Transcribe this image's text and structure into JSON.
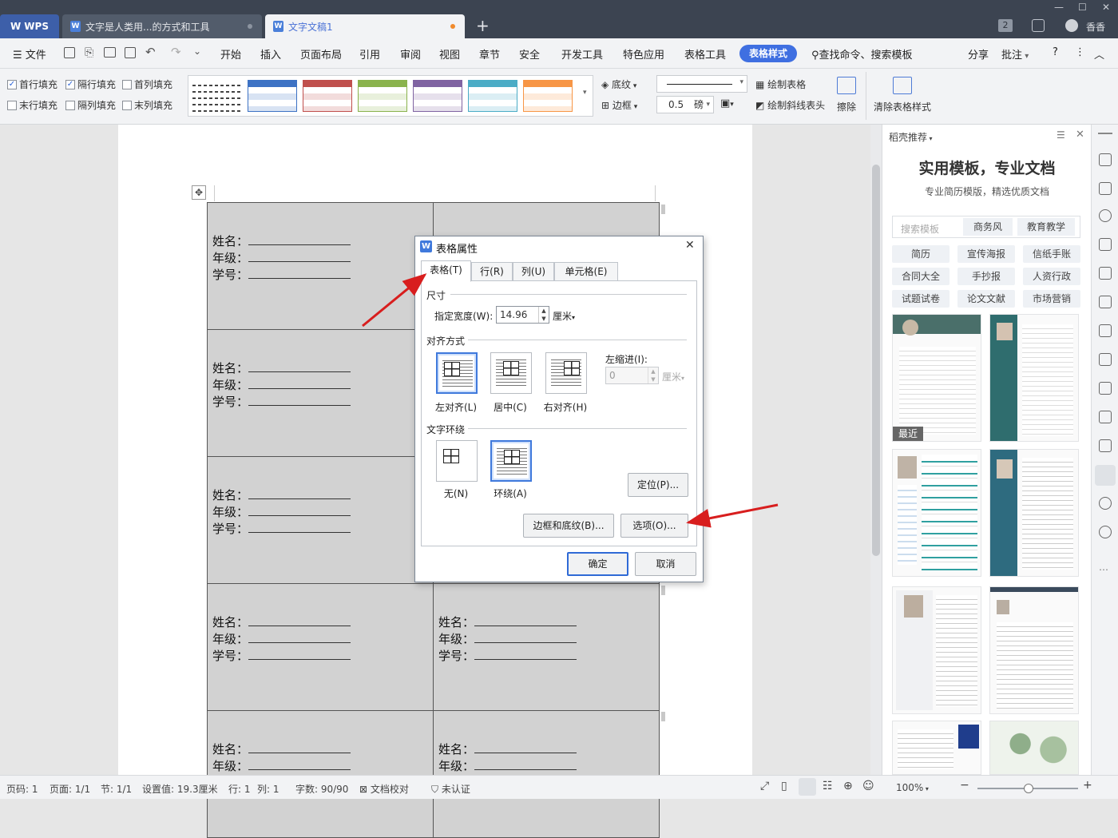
{
  "titlebar": {
    "wps_tab": "WPS",
    "tab1": "文字是人类用...的方式和工具",
    "tab2": "文字文稿1",
    "add_tab": "+",
    "badge": "2",
    "user": "香香"
  },
  "menubar": {
    "file": "文件",
    "items": [
      "开始",
      "插入",
      "页面布局",
      "引用",
      "审阅",
      "视图",
      "章节",
      "安全",
      "开发工具",
      "特色应用",
      "表格工具"
    ],
    "active": "表格样式",
    "search": "查找命令、搜索模板",
    "share": "分享",
    "comment": "批注"
  },
  "ribbon": {
    "checks": [
      {
        "label": "首行填充",
        "checked": true
      },
      {
        "label": "隔行填充",
        "checked": true
      },
      {
        "label": "首列填充",
        "checked": false
      },
      {
        "label": "末行填充",
        "checked": false
      },
      {
        "label": "隔列填充",
        "checked": false
      },
      {
        "label": "末列填充",
        "checked": false
      }
    ],
    "style_colors": [
      "#6b6b6b",
      "#3d72c4",
      "#c0504d",
      "#8ab34d",
      "#8064a2",
      "#4bacc6",
      "#f79646"
    ],
    "shading": "底纹",
    "border": "边框",
    "line_width": "0.5",
    "line_unit": "磅",
    "draw_table": "绘制表格",
    "draw_diagonal": "绘制斜线表头",
    "erase": "擦除",
    "clear_style": "清除表格样式"
  },
  "document": {
    "field_name": "姓名：",
    "field_grade": "年级：",
    "field_id": "学号："
  },
  "dialog": {
    "title": "表格属性",
    "close": "✕",
    "tabs": [
      "表格(T)",
      "行(R)",
      "列(U)",
      "单元格(E)"
    ],
    "size_section": "尺寸",
    "width_label": "指定宽度(W):",
    "width_value": "14.96",
    "width_unit": "厘米",
    "align_section": "对齐方式",
    "align_left": "左对齐(L)",
    "align_center": "居中(C)",
    "align_right": "右对齐(H)",
    "indent_label": "左缩进(I):",
    "indent_value": "0",
    "indent_unit": "厘米",
    "wrap_section": "文字环绕",
    "wrap_none": "无(N)",
    "wrap_around": "环绕(A)",
    "position_btn": "定位(P)...",
    "borders_btn": "边框和底纹(B)...",
    "options_btn": "选项(O)...",
    "ok_btn": "确定",
    "cancel_btn": "取消"
  },
  "sidebar": {
    "header": "稻壳推荐",
    "title": "实用模板，专业文档",
    "subtitle": "专业简历模版，精选优质文档",
    "search_placeholder": "搜索模板",
    "search_tag1": "商务风",
    "search_tag2": "教育教学",
    "chips": [
      "简历",
      "宣传海报",
      "信纸手账",
      "合同大全",
      "手抄报",
      "人资行政",
      "试题试卷",
      "论文文献",
      "市场营销"
    ],
    "recent": "最近"
  },
  "statusbar": {
    "page_num": "页码: 1",
    "pages": "页面: 1/1",
    "section": "节: 1/1",
    "setting": "设置值: 19.3厘米",
    "row": "行: 1",
    "col": "列: 1",
    "words": "字数: 90/90",
    "proof": "文档校对",
    "cert": "未认证",
    "zoom": "100%"
  }
}
